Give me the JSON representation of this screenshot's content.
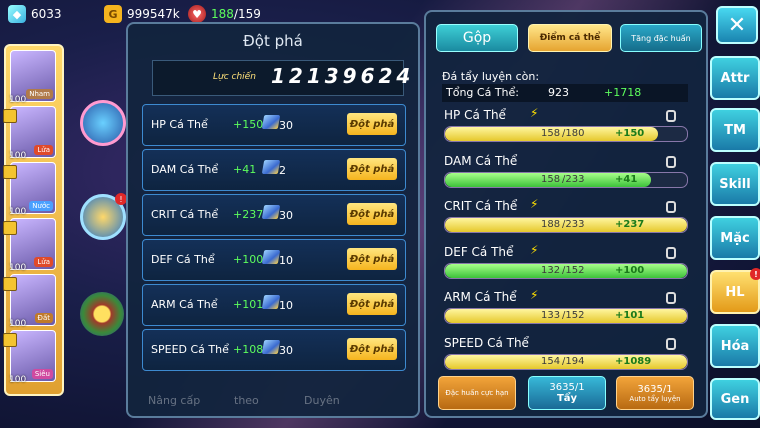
{
  "currencies": {
    "diamonds": "6033",
    "gold": "999547k",
    "stamina_current": "188",
    "stamina_max": "/159"
  },
  "monster_slots": [
    {
      "level": "100",
      "type": "Nham"
    },
    {
      "level": "100",
      "type": "Lửa"
    },
    {
      "level": "100",
      "type": "Nước"
    },
    {
      "level": "100",
      "type": "Lửa"
    },
    {
      "level": "100",
      "type": "Đất"
    },
    {
      "level": "100",
      "type": "Siêu"
    }
  ],
  "breakthrough_panel": {
    "title": "Đột phá",
    "power_label": "Lực chiến",
    "power_value": "12139624",
    "button_label": "Đột phá",
    "rows": [
      {
        "name": "HP Cá Thể",
        "bonus": "+150",
        "cost": "30"
      },
      {
        "name": "DAM Cá Thể",
        "bonus": "+41",
        "cost": "2"
      },
      {
        "name": "CRIT Cá Thể",
        "bonus": "+237",
        "cost": "30"
      },
      {
        "name": "DEF Cá Thể",
        "bonus": "+100",
        "cost": "10"
      },
      {
        "name": "ARM Cá Thể",
        "bonus": "+101",
        "cost": "10"
      },
      {
        "name": "SPEED Cá Thể",
        "bonus": "+1089",
        "cost": "30"
      }
    ],
    "background_buttons": [
      "Nâng cấp",
      "theo",
      "Duyên"
    ]
  },
  "ev_panel": {
    "tabs": [
      "Gộp",
      "Điểm cá thể",
      "Tăng đặc huấn"
    ],
    "remaining_label": "Đá tẩy luyện còn:",
    "total_label": "Tổng Cá Thể:",
    "total_value": "923",
    "total_bonus": "+1718",
    "stats": [
      {
        "name": "HP Cá Thể",
        "current": "158",
        "max": "/180",
        "bonus": "+150",
        "fill": 0.88,
        "color": "yellow",
        "bolt": true
      },
      {
        "name": "DAM Cá Thể",
        "current": "158",
        "max": "/233",
        "bonus": "+41",
        "fill": 0.85,
        "color": "green",
        "bolt": false
      },
      {
        "name": "CRIT Cá Thể",
        "current": "188",
        "max": "/233",
        "bonus": "+237",
        "fill": 1.0,
        "color": "yellow",
        "bolt": true
      },
      {
        "name": "DEF Cá Thể",
        "current": "132",
        "max": "/152",
        "bonus": "+100",
        "fill": 1.0,
        "color": "green",
        "bolt": true
      },
      {
        "name": "ARM Cá Thể",
        "current": "133",
        "max": "/152",
        "bonus": "+101",
        "fill": 1.0,
        "color": "yellow",
        "bolt": true
      },
      {
        "name": "SPEED Cá Thể",
        "current": "154",
        "max": "/194",
        "bonus": "+1089",
        "fill": 1.0,
        "color": "yellow",
        "bolt": false
      }
    ],
    "buttons": {
      "special_training": "Đặc huấn cực hạn",
      "wash_count": "3635/1",
      "wash_label": "Tẩy",
      "auto_count": "3635/1",
      "auto_label": "Auto tẩy luyện"
    }
  },
  "side_menu": [
    "Attr",
    "TM",
    "Skill",
    "Mặc",
    "HL",
    "Hóa",
    "Gen"
  ],
  "colors": {
    "accent_green": "#5dff5d",
    "gold_button": "#f5b41e",
    "cyan_button": "#1a7aa8",
    "panel_bg": "#12243e"
  }
}
